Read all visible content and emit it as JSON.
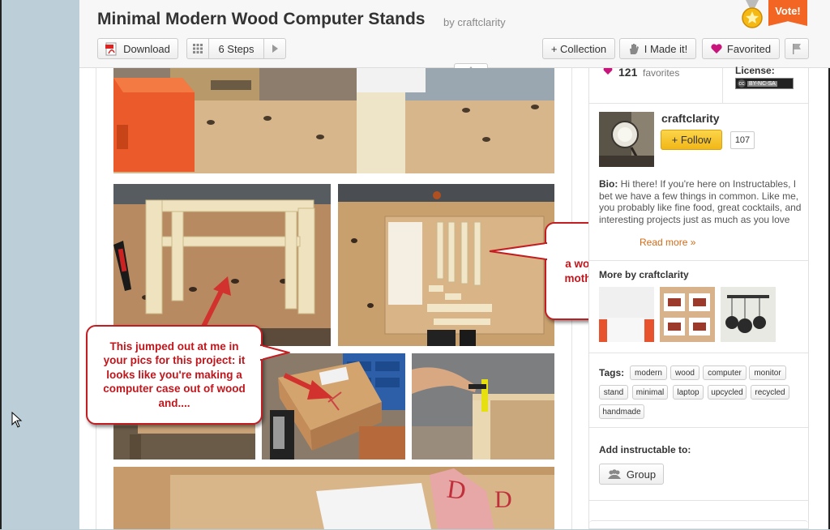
{
  "header": {
    "title": "Minimal Modern Wood Computer Stands",
    "byline": "by craftclarity",
    "download_label": "Download",
    "steps_label": "6 Steps",
    "collection_label": "+ Collection",
    "made_it_label": "I Made it!",
    "favorited_label": "Favorited",
    "vote_label": "Vote!"
  },
  "sidebar": {
    "favorites_count": "121",
    "favorites_label": "favorites",
    "license_label": "License:",
    "license_badge": "BY-NC-SA",
    "author_name": "craftclarity",
    "follow_label": "+ Follow",
    "follower_count": "107",
    "bio_label": "Bio:",
    "bio_text": "Hi there! If you're here on Instructables, I bet we have a few things in common. Like me, you probably like fine food, great cocktails, and interesting projects just as much as you love",
    "read_more": "Read more »",
    "more_by_label": "More by craftclarity",
    "tags_label": "Tags:",
    "tags": [
      "modern",
      "wood",
      "computer",
      "monitor",
      "stand",
      "minimal",
      "laptop",
      "upcycled",
      "recycled",
      "handmade"
    ],
    "add_to_label": "Add instructable to:",
    "group_label": "Group"
  },
  "annotations": {
    "callout_right": "a wooden atx motherboard.",
    "callout_left": "This jumped out at me in your pics for this project: it looks like you're making a computer case out of wood and...."
  },
  "colors": {
    "callout_red": "#c0161c",
    "vote_orange": "#f26522",
    "follow_yellow": "#f7c424",
    "heart_magenta": "#c8157c"
  }
}
